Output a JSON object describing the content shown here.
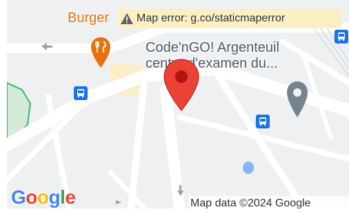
{
  "map": {
    "poi_restaurant_name_partial": "Burger",
    "poi_center_name_line1": "Code'nGO! Argenteuil",
    "poi_center_name_line2": "centre d'examen du...",
    "error_message": "Map error: g.co/staticmaperror",
    "attribution": "Map data ©2024 Google",
    "logo": {
      "G": "G",
      "o1": "o",
      "o2": "o",
      "g": "g",
      "l": "l",
      "e": "e"
    },
    "icons": [
      "warning-icon",
      "restaurant-icon",
      "bus-stop-icon",
      "location-pin-icon",
      "place-marker-icon"
    ],
    "colors": {
      "pin": "#ea4335",
      "restaurant": "#e8710a",
      "bus": "#1a73e8",
      "grey_marker": "#76838f"
    }
  }
}
